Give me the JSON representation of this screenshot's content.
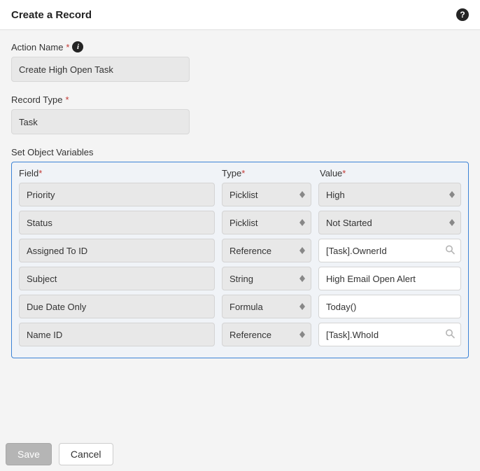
{
  "header": {
    "title": "Create a Record"
  },
  "form": {
    "action_name_label": "Action Name",
    "action_name_value": "Create High Open Task",
    "record_type_label": "Record Type",
    "record_type_value": "Task"
  },
  "variables_section": {
    "title": "Set Object Variables",
    "columns": {
      "field": "Field",
      "type": "Type",
      "value": "Value"
    },
    "rows": [
      {
        "field": "Priority",
        "type": "Picklist",
        "value": "High",
        "value_kind": "select"
      },
      {
        "field": "Status",
        "type": "Picklist",
        "value": "Not Started",
        "value_kind": "select"
      },
      {
        "field": "Assigned To ID",
        "type": "Reference",
        "value": "[Task].OwnerId",
        "value_kind": "lookup"
      },
      {
        "field": "Subject",
        "type": "String",
        "value": "High Email Open Alert",
        "value_kind": "text"
      },
      {
        "field": "Due Date Only",
        "type": "Formula",
        "value": "Today()",
        "value_kind": "text"
      },
      {
        "field": "Name ID",
        "type": "Reference",
        "value": "[Task].WhoId",
        "value_kind": "lookup"
      }
    ]
  },
  "buttons": {
    "save": "Save",
    "cancel": "Cancel"
  }
}
